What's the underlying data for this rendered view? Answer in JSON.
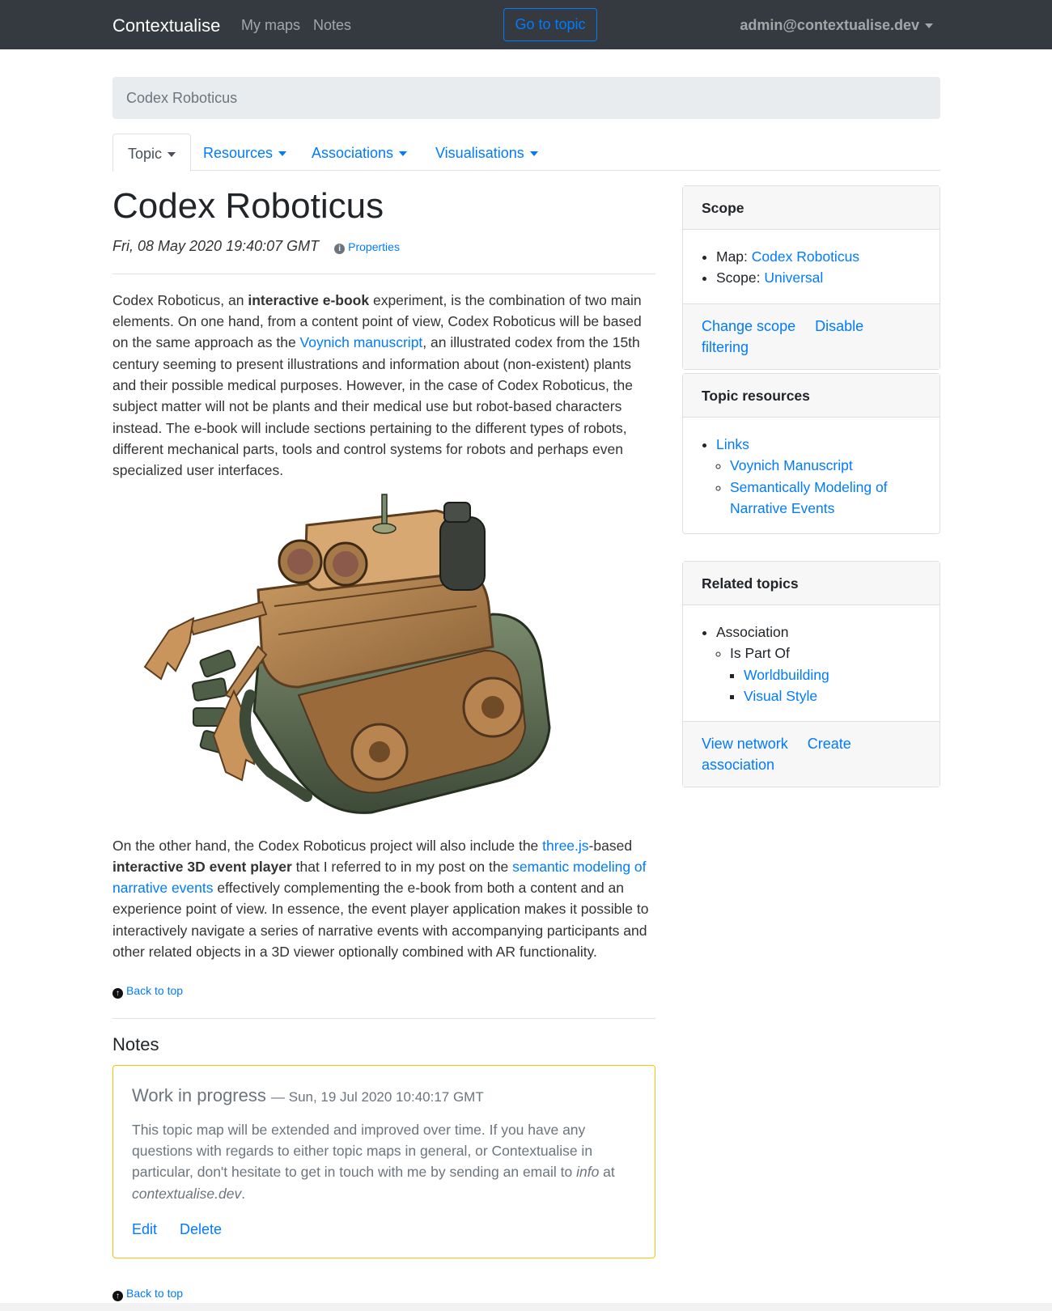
{
  "navbar": {
    "brand": "Contextualise",
    "links": [
      "My maps",
      "Notes"
    ],
    "go_to_topic": "Go to topic",
    "user": "admin@contextualise.dev"
  },
  "breadcrumb": "Codex Roboticus",
  "tabs": [
    "Topic",
    "Resources",
    "Associations",
    "Visualisations"
  ],
  "topic": {
    "title": "Codex Roboticus",
    "timestamp": "Fri, 08 May 2020 19:40:07 GMT",
    "properties_link": "Properties",
    "p1": {
      "t1": "Codex Roboticus, an ",
      "b1": "interactive e-book",
      "t2": " experiment, is the combination of two main elements. On one hand, from a content point of view, Codex Roboticus will be based on the same approach as the ",
      "a1": "Voynich manuscript",
      "t3": ", an illustrated codex from the 15th century seeming to present illustrations and information about (non-existent) plants and their possible medical purposes. However, in the case of Codex Roboticus, the subject matter will not be plants and their medical use but robot-based characters instead. The e-book will include sections pertaining to the different types of robots, different mechanical parts, tools and control systems for robots and perhaps even specialized user interfaces."
    },
    "p2": {
      "t1": "On the other hand, the Codex Roboticus project will also include the ",
      "a1": "three.js",
      "t2": "-based ",
      "b1": "interactive 3D event player",
      "t3": " that I referred to in my post on the ",
      "a2": "semantic modeling of narrative events",
      "t4": " effectively complementing the e-book from both a content and an experience point of view. In essence, the event player application makes it possible to interactively navigate a series of narrative events with accompanying participants and other related objects in a 3D viewer optionally combined with AR functionality."
    },
    "back_to_top": "Back to top"
  },
  "notes": {
    "heading": "Notes",
    "note": {
      "title": "Work in progress",
      "dash": "—",
      "timestamp": "Sun, 19 Jul 2020 10:40:17 GMT",
      "t1": "This topic map will be extended and improved over time. If you have any questions with regards to either topic maps in general, or Contextualise in particular, don't hesitate to get in touch with me by sending an email to ",
      "em1": "info",
      "t2": " at ",
      "em2": "contextualise.dev",
      "t3": ".",
      "edit": "Edit",
      "delete": "Delete"
    },
    "back_to_top": "Back to top"
  },
  "scope_card": {
    "header": "Scope",
    "map_label": "Map: ",
    "map_value": "Codex Roboticus",
    "scope_label": "Scope: ",
    "scope_value": "Universal",
    "change_scope": "Change scope",
    "disable_filtering": "Disable filtering"
  },
  "resources_card": {
    "header": "Topic resources",
    "links_label": "Links",
    "links": [
      "Voynich Manuscript",
      "Semantically Modeling of Narrative Events"
    ]
  },
  "related_card": {
    "header": "Related topics",
    "association": "Association",
    "role": "Is Part Of",
    "topics": [
      "Worldbuilding",
      "Visual Style"
    ],
    "view_network": "View network",
    "create_association": "Create association"
  },
  "colors": {
    "navbar_bg": "#343a40",
    "link": "#007bff",
    "note_border": "#ffc107"
  },
  "icons": [
    "info-icon",
    "arrow-up-circle-icon",
    "caret-down-icon"
  ]
}
